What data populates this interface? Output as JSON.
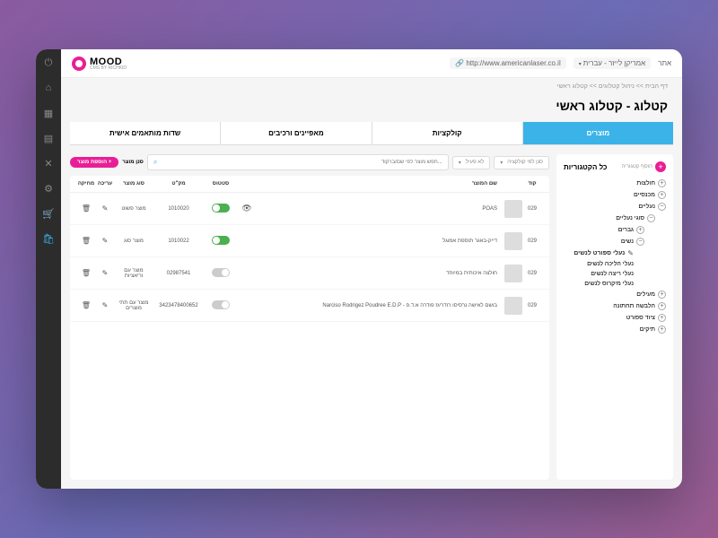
{
  "brand": {
    "name": "MOOD",
    "sub": "CMS BY RICHKID"
  },
  "topbar": {
    "url": "http://www.americanlaser.co.il",
    "site_label": "אמריקן לייזר - עברית",
    "site_prefix": "אתר"
  },
  "breadcrumb": "דף הבית >> ניהול קטלוגים >> קטלוג ראשי",
  "page_title": "קטלוג - קטלוג ראשי",
  "tabs": [
    "מוצרים",
    "קולקציות",
    "מאפיינים ורכיבים",
    "שדות מותאמים אישית"
  ],
  "categories": {
    "title": "כל הקטגוריות",
    "add_label": "הוסף קטגוריה",
    "tree": [
      {
        "label": "חולצות",
        "exp": "+"
      },
      {
        "label": "מכנסיים",
        "exp": "+"
      },
      {
        "label": "נעליים",
        "exp": "−",
        "children": [
          {
            "label": "סוגי נעליים",
            "exp": "−",
            "children": [
              {
                "label": "גברים",
                "exp": "+"
              },
              {
                "label": "נשים",
                "exp": "−",
                "children": [
                  {
                    "label": "נעלי ספורט לנשים",
                    "sel": true
                  },
                  {
                    "label": "נעלי הליכה לנשים"
                  },
                  {
                    "label": "נעלי ריצה לנשים"
                  },
                  {
                    "label": "נעלי מיקרוס לנשים"
                  }
                ]
              }
            ]
          }
        ]
      },
      {
        "label": "מעילים",
        "exp": "+"
      },
      {
        "label": "הלבשה תחתונה",
        "exp": "+"
      },
      {
        "label": "ציוד ספורט",
        "exp": "+"
      },
      {
        "label": "תיקים",
        "exp": "+"
      }
    ]
  },
  "filters": {
    "collection": "סנן לפי קולקציה",
    "active": "לא פעיל",
    "search_placeholder": "...חפש מוצר לפי שם/ברקוד",
    "sort": "סנן מוצר",
    "add_product": "+ הוספת מוצר"
  },
  "table": {
    "headers": {
      "code": "קוד",
      "name": "שם המוצר",
      "status": "סטטוס",
      "sku": "מק\"ט",
      "type": "סוג מוצר",
      "edit": "עריכה",
      "delete": "מחיקה"
    },
    "rows": [
      {
        "code": "029",
        "name": "POAS",
        "status": "on",
        "vis": true,
        "sku": "1010020",
        "type": "מוצר פשוט"
      },
      {
        "code": "029",
        "name": "דייק-באגר תוספת אמוגל",
        "status": "on",
        "vis": false,
        "sku": "1010022",
        "type": "מוצר סוג"
      },
      {
        "code": "029",
        "name": "חולצה איכותית במיוחד",
        "status": "off",
        "vis": false,
        "sku": "02987541",
        "type": "מוצר עם וריאציות"
      },
      {
        "code": "029",
        "name": "בושם לאישה נרסיסו רודריגז פודרה א.ד.פ - Narciso Rodrigez Poudree E.D.P",
        "status": "off",
        "vis": false,
        "sku": "3423478400652",
        "type": "מוצר עם תתי מוצרים"
      }
    ]
  }
}
